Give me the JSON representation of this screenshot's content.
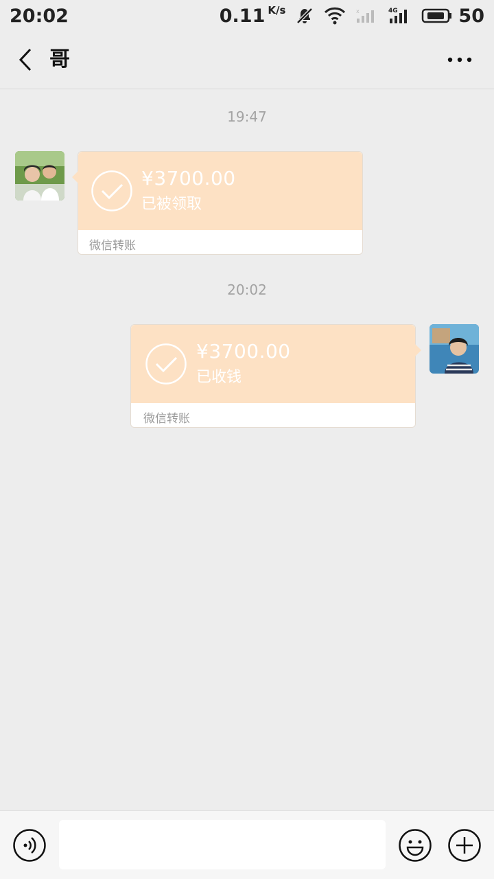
{
  "status_bar": {
    "time": "20:02",
    "net_speed": "0.11",
    "net_unit": "K/s",
    "network_label": "4G",
    "battery": "50",
    "icons": [
      "mute-bell-icon",
      "wifi-icon",
      "signal-icon",
      "signal-4g-icon",
      "battery-icon"
    ]
  },
  "header": {
    "title": "哥",
    "back_icon": "chevron-left-icon",
    "more_icon": "more-dots-icon"
  },
  "messages": [
    {
      "timestamp": "19:47",
      "side": "left",
      "amount": "¥3700.00",
      "status": "已被领取",
      "footer": "微信转账"
    },
    {
      "timestamp": "20:02",
      "side": "right",
      "amount": "¥3700.00",
      "status": "已收钱",
      "footer": "微信转账"
    }
  ],
  "input_bar": {
    "text": "",
    "icons": [
      "voice-icon",
      "emoji-icon",
      "plus-icon"
    ]
  },
  "colors": {
    "background": "#ededed",
    "transfer_card": "#fde1c4",
    "text_muted": "#a3a3a3"
  }
}
